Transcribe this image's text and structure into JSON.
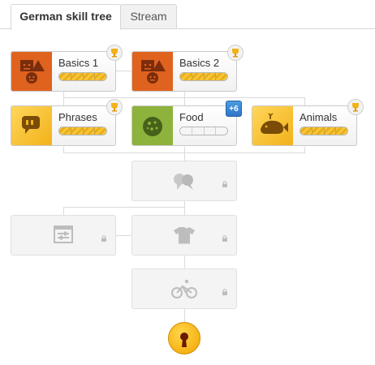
{
  "tabs": [
    {
      "label": "German skill tree",
      "active": true
    },
    {
      "label": "Stream",
      "active": false
    }
  ],
  "skills": [
    {
      "name": "Basics 1",
      "icon": "faces-shapes-icon",
      "icon_color": "#e0621f",
      "progress": "4/4",
      "badge": "trophy-icon"
    },
    {
      "name": "Basics 2",
      "icon": "faces-shapes-icon",
      "icon_color": "#e0621f",
      "progress": "4/4",
      "badge": "trophy-icon"
    },
    {
      "name": "Phrases",
      "icon": "speech-bubble-icon",
      "icon_color": "#f2b21a",
      "progress": "4/4",
      "badge": "trophy-icon"
    },
    {
      "name": "Food",
      "icon": "pizza-icon",
      "icon_color": "#8db33c",
      "progress": "0/4",
      "badge_text": "+6"
    },
    {
      "name": "Animals",
      "icon": "whale-icon",
      "icon_color": "#f2b21a",
      "progress": "4/4",
      "badge": "trophy-icon"
    }
  ],
  "locked_skills": [
    {
      "icon": "speech-bubbles-icon"
    },
    {
      "icon": "form-icon"
    },
    {
      "icon": "shirt-icon"
    },
    {
      "icon": "bicycle-icon"
    }
  ],
  "key": {
    "icon": "keyhole-icon",
    "color": "#f2a400"
  }
}
